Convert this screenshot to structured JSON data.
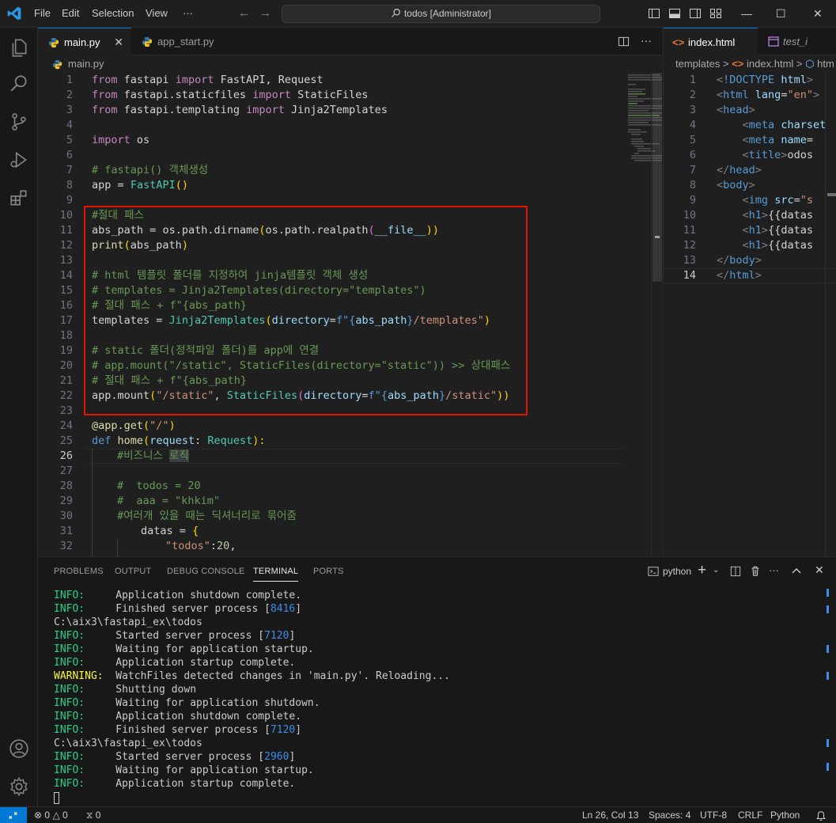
{
  "titlebar": {
    "menus": [
      "File",
      "Edit",
      "Selection",
      "View",
      "···"
    ],
    "command_center": "todos [Administrator]"
  },
  "editor1": {
    "tabs": [
      {
        "label": "main.py",
        "active": true
      },
      {
        "label": "app_start.py",
        "active": false
      }
    ],
    "breadcrumb": "main.py",
    "lines": [
      {
        "n": "1"
      },
      {
        "n": "2"
      },
      {
        "n": "3"
      },
      {
        "n": "4"
      },
      {
        "n": "5"
      },
      {
        "n": "6"
      },
      {
        "n": "7"
      },
      {
        "n": "8"
      },
      {
        "n": "9"
      },
      {
        "n": "10"
      },
      {
        "n": "11"
      },
      {
        "n": "12"
      },
      {
        "n": "13"
      },
      {
        "n": "14"
      },
      {
        "n": "15"
      },
      {
        "n": "16"
      },
      {
        "n": "17"
      },
      {
        "n": "18"
      },
      {
        "n": "19"
      },
      {
        "n": "20"
      },
      {
        "n": "21"
      },
      {
        "n": "22"
      },
      {
        "n": "23"
      },
      {
        "n": "24"
      },
      {
        "n": "25"
      },
      {
        "n": "26"
      },
      {
        "n": "27"
      },
      {
        "n": "28"
      },
      {
        "n": "29"
      },
      {
        "n": "30"
      },
      {
        "n": "31"
      },
      {
        "n": "32"
      }
    ],
    "code": {
      "l1": [
        "from",
        "fastapi",
        "import",
        "FastAPI, Request"
      ],
      "l2": [
        "from",
        "fastapi.staticfiles",
        "import",
        "StaticFiles"
      ],
      "l3": [
        "from",
        "fastapi.templating",
        "import",
        "Jinja2Templates"
      ],
      "l5": [
        "import",
        "os"
      ],
      "l7": "# fastapi() 객체생성",
      "l8": [
        "app",
        "=",
        "FastAPI",
        "()"
      ],
      "l10": "#절대 패스",
      "l11": [
        "abs_path",
        "=",
        "os.path.dirname",
        "(",
        "os.path.realpath",
        "(",
        "__file__",
        "))"
      ],
      "l12": [
        "print",
        "(",
        "abs_path",
        ")"
      ],
      "l14": "# html 템플릿 폴더를 지정하여 jinja템플릿 객체 생성",
      "l15": "# templates = Jinja2Templates(directory=\"templates\")",
      "l16": "# 절대 패스 + f\"{abs_path}",
      "l17": [
        "templates",
        "=",
        "Jinja2Templates",
        "(",
        "directory",
        "=",
        "f\"",
        "{",
        "abs_path",
        "}",
        "/templates\"",
        ")"
      ],
      "l19": "# static 폴더(정적파일 폴더)를 app에 연결",
      "l20": "# app.mount(\"/static\", StaticFiles(directory=\"static\")) >> 상대패스",
      "l21": "# 절대 패스 + f\"{abs_path}",
      "l22": [
        "app.mount",
        "(",
        "\"/static\"",
        ", ",
        "StaticFiles",
        "(",
        "directory",
        "=",
        "f\"",
        "{",
        "abs_path",
        "}",
        "/static\"",
        "))"
      ],
      "l24": [
        "@app.get",
        "(",
        "\"/\"",
        ")"
      ],
      "l25": [
        "def",
        "home",
        "(",
        "request",
        ": ",
        "Request",
        "):"
      ],
      "l26": [
        "#비즈니스 ",
        "로직"
      ],
      "l28": "#  todos = 20",
      "l29": "#  aaa = \"khkim\"",
      "l30": "#여러개 있을 때는 딕셔너리로 묶어줌",
      "l31": [
        "datas",
        "=",
        "{"
      ],
      "l32": [
        "\"todos\"",
        ":",
        "20",
        ","
      ]
    }
  },
  "editor2": {
    "tabs": [
      {
        "label": "index.html",
        "active": true
      },
      {
        "label": "test_i",
        "active": false
      }
    ],
    "breadcrumb": [
      "templates",
      ">",
      "index.html",
      ">",
      "htm"
    ],
    "lines": [
      {
        "n": "1",
        "parts": [
          [
            "ang",
            "<"
          ],
          [
            "tag",
            "!DOCTYPE"
          ],
          [
            "p",
            " "
          ],
          [
            "attr",
            "html"
          ],
          [
            "ang",
            ">"
          ]
        ]
      },
      {
        "n": "2",
        "parts": [
          [
            "ang",
            "<"
          ],
          [
            "tag",
            "html"
          ],
          [
            "p",
            " "
          ],
          [
            "attr",
            "lang"
          ],
          [
            "p",
            "="
          ],
          [
            "s",
            "\"en\""
          ],
          [
            "ang",
            ">"
          ]
        ]
      },
      {
        "n": "3",
        "parts": [
          [
            "ang",
            "<"
          ],
          [
            "tag",
            "head"
          ],
          [
            "ang",
            ">"
          ]
        ]
      },
      {
        "n": "4",
        "parts": [
          [
            "p",
            "    "
          ],
          [
            "ang",
            "<"
          ],
          [
            "tag",
            "meta"
          ],
          [
            "p",
            " "
          ],
          [
            "attr",
            "charset"
          ]
        ]
      },
      {
        "n": "5",
        "parts": [
          [
            "p",
            "    "
          ],
          [
            "ang",
            "<"
          ],
          [
            "tag",
            "meta"
          ],
          [
            "p",
            " "
          ],
          [
            "attr",
            "name"
          ],
          [
            "p",
            "="
          ]
        ]
      },
      {
        "n": "6",
        "parts": [
          [
            "p",
            "    "
          ],
          [
            "ang",
            "<"
          ],
          [
            "tag",
            "title"
          ],
          [
            "ang",
            ">"
          ],
          [
            "p",
            "odos"
          ]
        ]
      },
      {
        "n": "7",
        "parts": [
          [
            "ang",
            "</"
          ],
          [
            "tag",
            "head"
          ],
          [
            "ang",
            ">"
          ]
        ]
      },
      {
        "n": "8",
        "parts": [
          [
            "ang",
            "<"
          ],
          [
            "tag",
            "body"
          ],
          [
            "ang",
            ">"
          ]
        ]
      },
      {
        "n": "9",
        "parts": [
          [
            "p",
            "    "
          ],
          [
            "ang",
            "<"
          ],
          [
            "tag",
            "img"
          ],
          [
            "p",
            " "
          ],
          [
            "attr",
            "src"
          ],
          [
            "p",
            "="
          ],
          [
            "s",
            "\"s"
          ]
        ]
      },
      {
        "n": "10",
        "parts": [
          [
            "p",
            "    "
          ],
          [
            "ang",
            "<"
          ],
          [
            "tag",
            "h1"
          ],
          [
            "ang",
            ">"
          ],
          [
            "p",
            "{{datas"
          ]
        ]
      },
      {
        "n": "11",
        "parts": [
          [
            "p",
            "    "
          ],
          [
            "ang",
            "<"
          ],
          [
            "tag",
            "h1"
          ],
          [
            "ang",
            ">"
          ],
          [
            "p",
            "{{datas"
          ]
        ]
      },
      {
        "n": "12",
        "parts": [
          [
            "p",
            "    "
          ],
          [
            "ang",
            "<"
          ],
          [
            "tag",
            "h1"
          ],
          [
            "ang",
            ">"
          ],
          [
            "p",
            "{{datas"
          ]
        ]
      },
      {
        "n": "13",
        "parts": [
          [
            "ang",
            "</"
          ],
          [
            "tag",
            "body"
          ],
          [
            "ang",
            ">"
          ]
        ]
      },
      {
        "n": "14",
        "parts": [
          [
            "ang",
            "</"
          ],
          [
            "tag",
            "html"
          ],
          [
            "ang",
            ">"
          ]
        ]
      }
    ]
  },
  "panel": {
    "tabs": [
      "PROBLEMS",
      "OUTPUT",
      "DEBUG CONSOLE",
      "TERMINAL",
      "PORTS"
    ],
    "active_tab": "TERMINAL",
    "terminal_name": "python",
    "terminal_lines": [
      {
        "level": "INFO:",
        "text": "     Application shutdown complete."
      },
      {
        "level": "INFO:",
        "text": "     Finished server process [",
        "num": "8416",
        "tail": "]"
      },
      {
        "level": "",
        "text": "C:\\aix3\\fastapi_ex\\todos"
      },
      {
        "level": "INFO:",
        "text": "     Started server process [",
        "num": "7120",
        "tail": "]"
      },
      {
        "level": "INFO:",
        "text": "     Waiting for application startup."
      },
      {
        "level": "INFO:",
        "text": "     Application startup complete."
      },
      {
        "level": "WARNING:",
        "text": "  WatchFiles detected changes in 'main.py'. Reloading..."
      },
      {
        "level": "INFO:",
        "text": "     Shutting down"
      },
      {
        "level": "INFO:",
        "text": "     Waiting for application shutdown."
      },
      {
        "level": "INFO:",
        "text": "     Application shutdown complete."
      },
      {
        "level": "INFO:",
        "text": "     Finished server process [",
        "num": "7120",
        "tail": "]"
      },
      {
        "level": "",
        "text": "C:\\aix3\\fastapi_ex\\todos"
      },
      {
        "level": "INFO:",
        "text": "     Started server process [",
        "num": "2960",
        "tail": "]"
      },
      {
        "level": "INFO:",
        "text": "     Waiting for application startup."
      },
      {
        "level": "INFO:",
        "text": "     Application startup complete."
      }
    ]
  },
  "statusbar": {
    "errors": "0",
    "warnings": "0",
    "ports": "0",
    "position": "Ln 26, Col 13",
    "spaces": "Spaces: 4",
    "encoding": "UTF-8",
    "eol": "CRLF",
    "language": "Python"
  },
  "colors": {
    "accent": "#0078d4",
    "highlight_box": "#e51400"
  }
}
